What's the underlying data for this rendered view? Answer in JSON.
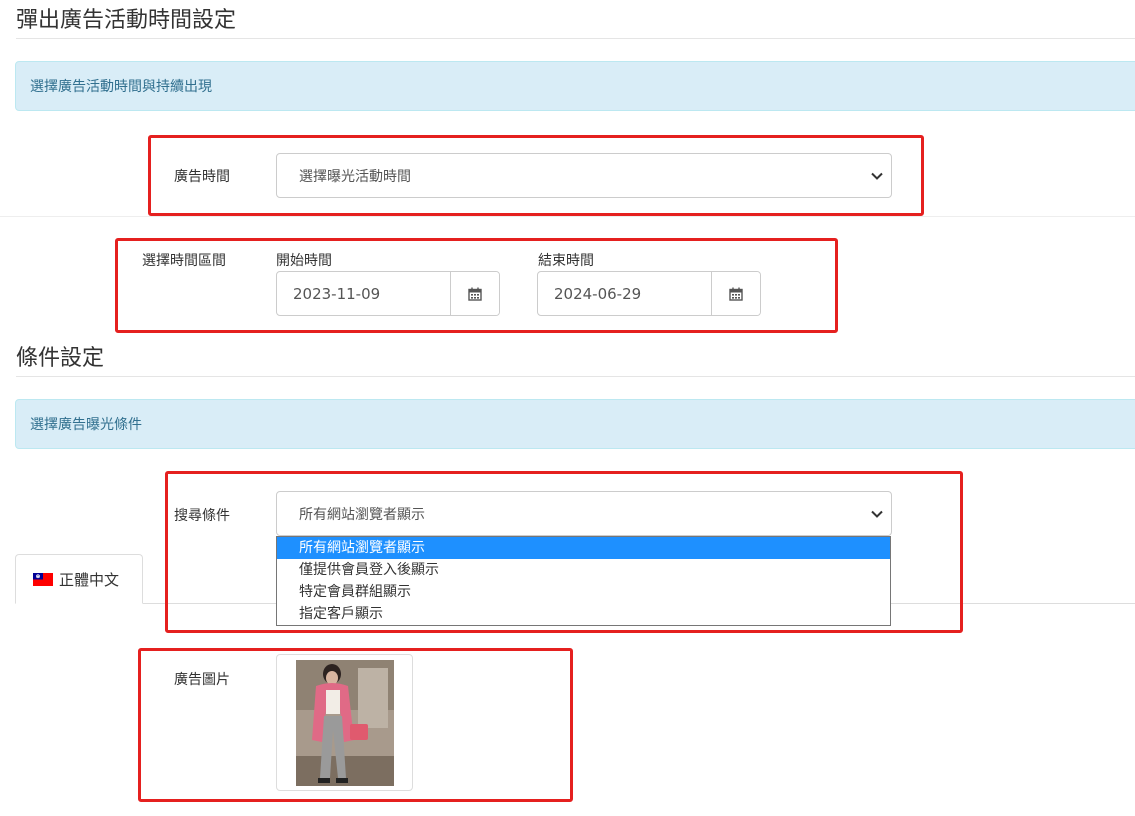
{
  "sections": {
    "schedule": {
      "title": "彈出廣告活動時間設定",
      "info": "選擇廣告活動時間與持續出現",
      "time_label": "廣告時間",
      "time_select": "選擇曝光活動時間",
      "range_label": "選擇時間區間",
      "start_label": "開始時間",
      "start_value": "2023-11-09",
      "end_label": "結束時間",
      "end_value": "2024-06-29"
    },
    "conditions": {
      "title": "條件設定",
      "info": "選擇廣告曝光條件",
      "search_label": "搜尋條件",
      "search_value": "所有網站瀏覽者顯示",
      "options": [
        "所有網站瀏覽者顯示",
        "僅提供會員登入後顯示",
        "特定會員群組顯示",
        "指定客戶顯示"
      ],
      "selected_index": 0
    },
    "language": {
      "tab_label": "正體中文",
      "flag_icon": "taiwan-flag-icon"
    },
    "image": {
      "label": "廣告圖片"
    }
  },
  "colors": {
    "highlight": "#e5201f",
    "info_bg": "#d9edf7",
    "info_text": "#31708f",
    "option_selected": "#1e90ff"
  }
}
